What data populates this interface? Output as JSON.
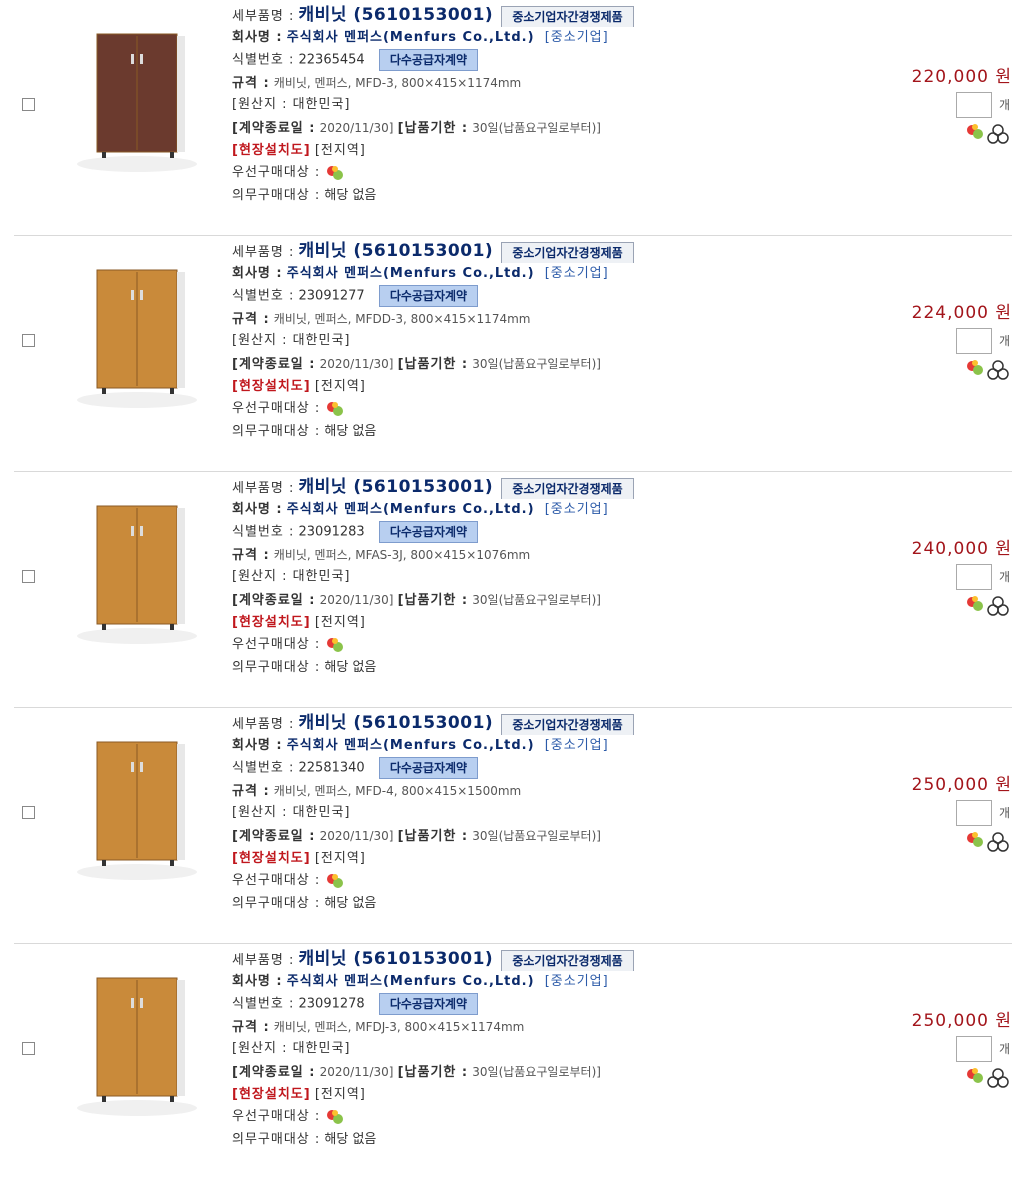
{
  "labels": {
    "detail_name": "세부품명 :",
    "company": "회사명 :",
    "id": "식별번호 :",
    "spec": "규격 :",
    "origin": "[원산지 : 대한민국]",
    "contract_end": "[계약종료일 :",
    "delivery": "[납품기한 :",
    "install": "[현장설치도]",
    "install_area": "[전지역]",
    "priority": "우선구매대상 :",
    "mandatory": "의무구매대상 :",
    "mandatory_value": "해당 없음",
    "unit": "개"
  },
  "items": [
    {
      "name": "캐비닛 (5610153001)",
      "badge_gray": "중소기업자간경쟁제품",
      "company": "주식회사 멘퍼스(Menfurs Co.,Ltd.)",
      "company_tag": "[중소기업]",
      "id_number": "22365454",
      "badge_blue": "다수공급자계약",
      "spec": "캐비닛, 멘퍼스, MFD-3, 800×415×1174mm",
      "contract_end_date": "2020/11/30]",
      "delivery_value": "30일(납품요구일로부터)]",
      "price": "220,000 원",
      "cabinet_color": "#6b3a2e"
    },
    {
      "name": "캐비닛 (5610153001)",
      "badge_gray": "중소기업자간경쟁제품",
      "company": "주식회사 멘퍼스(Menfurs Co.,Ltd.)",
      "company_tag": "[중소기업]",
      "id_number": "23091277",
      "badge_blue": "다수공급자계약",
      "spec": "캐비닛, 멘퍼스, MFDD-3, 800×415×1174mm",
      "contract_end_date": "2020/11/30]",
      "delivery_value": "30일(납품요구일로부터)]",
      "price": "224,000 원",
      "cabinet_color": "#c98a3a"
    },
    {
      "name": "캐비닛 (5610153001)",
      "badge_gray": "중소기업자간경쟁제품",
      "company": "주식회사 멘퍼스(Menfurs Co.,Ltd.)",
      "company_tag": "[중소기업]",
      "id_number": "23091283",
      "badge_blue": "다수공급자계약",
      "spec": "캐비닛, 멘퍼스, MFAS-3J, 800×415×1076mm",
      "contract_end_date": "2020/11/30]",
      "delivery_value": "30일(납품요구일로부터)]",
      "price": "240,000 원",
      "cabinet_color": "#c98a3a"
    },
    {
      "name": "캐비닛 (5610153001)",
      "badge_gray": "중소기업자간경쟁제품",
      "company": "주식회사 멘퍼스(Menfurs Co.,Ltd.)",
      "company_tag": "[중소기업]",
      "id_number": "22581340",
      "badge_blue": "다수공급자계약",
      "spec": "캐비닛, 멘퍼스, MFD-4, 800×415×1500mm",
      "contract_end_date": "2020/11/30]",
      "delivery_value": "30일(납품요구일로부터)]",
      "price": "250,000 원",
      "cabinet_color": "#c98a3a"
    },
    {
      "name": "캐비닛 (5610153001)",
      "badge_gray": "중소기업자간경쟁제품",
      "company": "주식회사 멘퍼스(Menfurs Co.,Ltd.)",
      "company_tag": "[중소기업]",
      "id_number": "23091278",
      "badge_blue": "다수공급자계약",
      "spec": "캐비닛, 멘퍼스, MFDJ-3, 800×415×1174mm",
      "contract_end_date": "2020/11/30]",
      "delivery_value": "30일(납품요구일로부터)]",
      "price": "250,000 원",
      "cabinet_color": "#c98a3a"
    }
  ]
}
